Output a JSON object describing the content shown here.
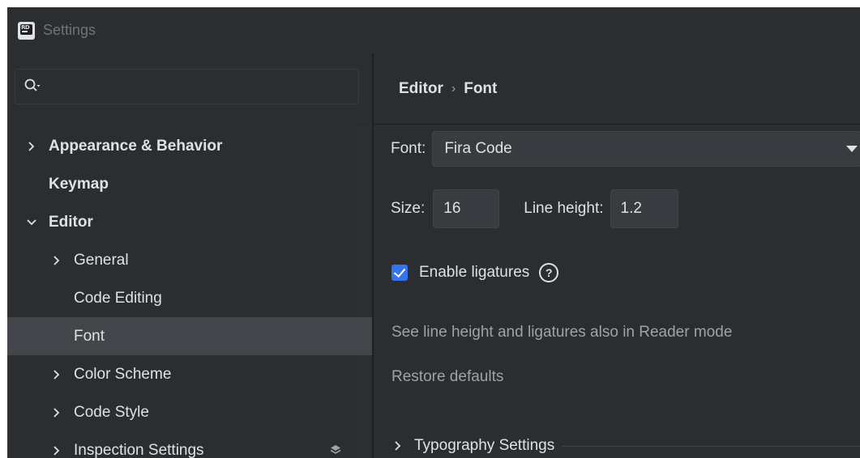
{
  "window": {
    "title": "Settings",
    "app_icon": "rider-logo-icon",
    "app_icon_text": "RD"
  },
  "search": {
    "value": "",
    "placeholder": ""
  },
  "sidebar": {
    "items": [
      {
        "label": "Appearance & Behavior",
        "bold": true,
        "expanded": false,
        "has_children": true
      },
      {
        "label": "Keymap",
        "bold": true,
        "has_children": false
      },
      {
        "label": "Editor",
        "bold": true,
        "expanded": true,
        "has_children": true
      },
      {
        "label": "General",
        "bold": false,
        "expanded": false,
        "has_children": true
      },
      {
        "label": "Code Editing",
        "bold": false,
        "has_children": false
      },
      {
        "label": "Font",
        "bold": false,
        "has_children": false,
        "selected": true
      },
      {
        "label": "Color Scheme",
        "bold": false,
        "expanded": false,
        "has_children": true
      },
      {
        "label": "Code Style",
        "bold": false,
        "expanded": false,
        "has_children": true
      },
      {
        "label": "Inspection Settings",
        "bold": false,
        "expanded": false,
        "has_children": true,
        "trailing_icon": "layers-icon"
      }
    ]
  },
  "breadcrumb": {
    "parent": "Editor",
    "separator": "›",
    "current": "Font"
  },
  "font": {
    "label": "Font:",
    "value": "Fira Code"
  },
  "size": {
    "label": "Size:",
    "value": "16"
  },
  "line_height": {
    "label": "Line height:",
    "value": "1.2"
  },
  "ligatures": {
    "label": "Enable ligatures",
    "checked": true
  },
  "links": {
    "reader_mode": "See line height and ligatures also in Reader mode",
    "restore": "Restore defaults"
  },
  "typography": {
    "label": "Typography Settings"
  },
  "colors": {
    "background": "#2b2d30",
    "selected_row": "#43454a",
    "field": "#393b40",
    "accent": "#3574f0",
    "text": "#dfe1e5",
    "muted_text": "#9fa2a8"
  }
}
